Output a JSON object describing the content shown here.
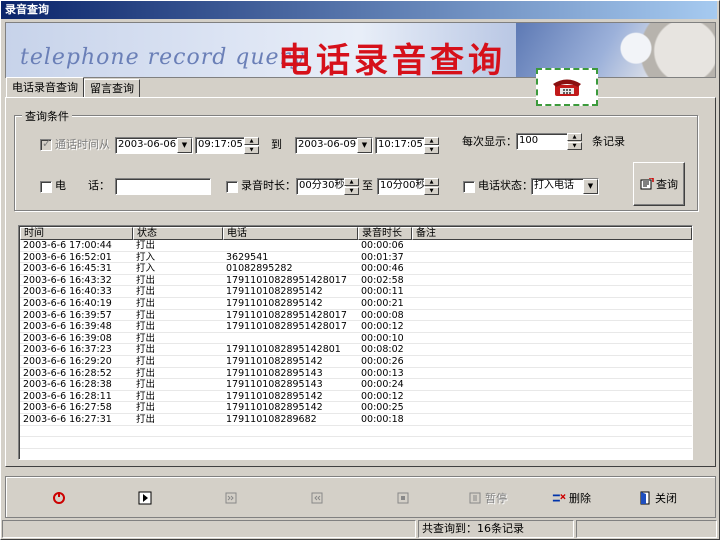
{
  "window": {
    "title": "录音查询"
  },
  "banner": {
    "english_text": "telephone record query",
    "chinese_text": "电话录音查询"
  },
  "tabs": [
    {
      "label": "电话录音查询",
      "active": true
    },
    {
      "label": "留言查询",
      "active": false
    }
  ],
  "query": {
    "group_title": "查询条件",
    "call_time_label": "通话时间从",
    "call_time_checked": true,
    "from_date": "2003-06-06",
    "from_time": "09:17:05",
    "to_label": "到",
    "to_date": "2003-06-09",
    "to_time": "10:17:05",
    "per_page_label": "每次显示：",
    "per_page_value": "100",
    "per_page_unit": "条记录",
    "phone_label": "电　　话：",
    "phone_value": "",
    "duration_label": "录音时长：",
    "duration_from": "00分30秒",
    "duration_to_label": "至",
    "duration_to": "10分00秒",
    "status_label": "电话状态：",
    "status_value": "打入电话",
    "search_button": "查询"
  },
  "table": {
    "columns": [
      "时间",
      "状态",
      "电话",
      "录音时长",
      "备注"
    ],
    "rows": [
      [
        "2003-6-6 17:00:44",
        "打出",
        "",
        "00:00:06",
        ""
      ],
      [
        "2003-6-6 16:52:01",
        "打入",
        "3629541",
        "00:01:37",
        ""
      ],
      [
        "2003-6-6 16:45:31",
        "打入",
        "01082895282",
        "00:00:46",
        ""
      ],
      [
        "2003-6-6 16:43:32",
        "打出",
        "17911010828951428017",
        "00:02:58",
        ""
      ],
      [
        "2003-6-6 16:40:33",
        "打出",
        "179110108289514​2",
        "00:00:11",
        ""
      ],
      [
        "2003-6-6 16:40:19",
        "打出",
        "179110108289514​2",
        "00:00:21",
        ""
      ],
      [
        "2003-6-6 16:39:57",
        "打出",
        "17911010828951428017",
        "00:00:08",
        ""
      ],
      [
        "2003-6-6 16:39:48",
        "打出",
        "17911010828951428017",
        "00:00:12",
        ""
      ],
      [
        "2003-6-6 16:39:08",
        "打出",
        "",
        "00:00:10",
        ""
      ],
      [
        "2003-6-6 16:37:23",
        "打出",
        "1791101082895142801",
        "00:08:02",
        ""
      ],
      [
        "2003-6-6 16:29:20",
        "打出",
        "179110108289514​2",
        "00:00:26",
        ""
      ],
      [
        "2003-6-6 16:28:52",
        "打出",
        "179110108289514​3",
        "00:00:13",
        ""
      ],
      [
        "2003-6-6 16:28:38",
        "打出",
        "179110108289514​3",
        "00:00:24",
        ""
      ],
      [
        "2003-6-6 16:28:11",
        "打出",
        "179110108289514​2",
        "00:00:12",
        ""
      ],
      [
        "2003-6-6 16:27:58",
        "打出",
        "179110108289514​2",
        "00:00:25",
        ""
      ],
      [
        "2003-6-6 16:27:31",
        "打出",
        "179110108289682",
        "00:00:18",
        ""
      ]
    ],
    "empty_rows": 3
  },
  "toolbar": {
    "play_icon": "replay-icon",
    "pause_label": "暂停",
    "delete_label": "删除",
    "close_label": "关闭"
  },
  "status": {
    "result_text": "共查询到：16条记录"
  }
}
